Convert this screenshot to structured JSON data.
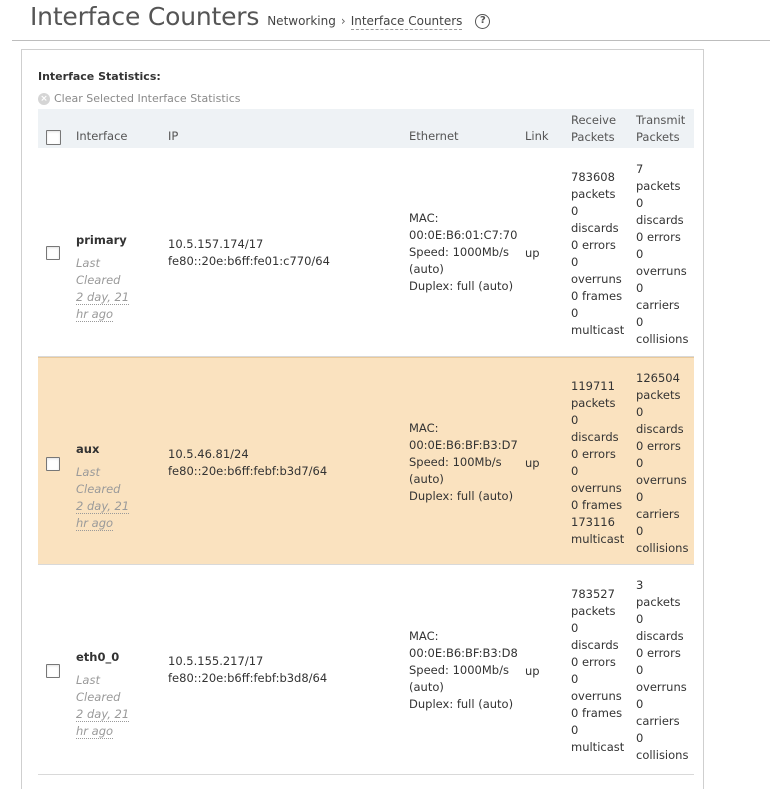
{
  "header": {
    "title": "Interface Counters",
    "breadcrumb_root": "Networking",
    "breadcrumb_sep": "›",
    "breadcrumb_current": "Interface Counters",
    "help_glyph": "?"
  },
  "section": {
    "title": "Interface Statistics:",
    "clear_label": "Clear Selected Interface Statistics"
  },
  "columns": {
    "interface": "Interface",
    "ip": "IP",
    "ethernet": "Ethernet",
    "link": "Link",
    "receive": "Receive Packets",
    "transmit": "Transmit Packets"
  },
  "rows": [
    {
      "name": "primary",
      "last_cleared_label": "Last Cleared",
      "last_cleared_value": "2 day, 21 hr ago",
      "ipv4": "10.5.157.174/17",
      "ipv6": "fe80::20e:b6ff:fe01:c770/64",
      "mac_label": "MAC:",
      "mac": "00:0E:B6:01:C7:70",
      "speed": "Speed: 1000Mb/s",
      "speed_mode": "(auto)",
      "duplex": "Duplex: full (auto)",
      "link": "up",
      "rx": [
        "783608",
        "packets",
        "0",
        "discards",
        "0 errors",
        "0",
        "overruns",
        "0 frames",
        "0",
        "multicast"
      ],
      "tx": [
        "7",
        "packets",
        "0",
        "discards",
        "0 errors",
        "0",
        "overruns",
        "0",
        "carriers",
        "0",
        "collisions"
      ]
    },
    {
      "name": "aux",
      "last_cleared_label": "Last Cleared",
      "last_cleared_value": "2 day, 21 hr ago",
      "ipv4": "10.5.46.81/24",
      "ipv6": "fe80::20e:b6ff:febf:b3d7/64",
      "mac_label": "MAC:",
      "mac": "00:0E:B6:BF:B3:D7",
      "speed": "Speed: 100Mb/s",
      "speed_mode": "(auto)",
      "duplex": "Duplex: full (auto)",
      "link": "up",
      "rx": [
        "119711",
        "packets",
        "0",
        "discards",
        "0 errors",
        "0",
        "overruns",
        "0 frames",
        "173116",
        "multicast"
      ],
      "tx": [
        "126504",
        "packets",
        "0",
        "discards",
        "0 errors",
        "0",
        "overruns",
        "0",
        "carriers",
        "0",
        "collisions"
      ]
    },
    {
      "name": "eth0_0",
      "last_cleared_label": "Last Cleared",
      "last_cleared_value": "2 day, 21 hr ago",
      "ipv4": "10.5.155.217/17",
      "ipv6": "fe80::20e:b6ff:febf:b3d8/64",
      "mac_label": "MAC:",
      "mac": "00:0E:B6:BF:B3:D8",
      "speed": "Speed: 1000Mb/s",
      "speed_mode": "(auto)",
      "duplex": "Duplex: full (auto)",
      "link": "up",
      "rx": [
        "783527",
        "packets",
        "0",
        "discards",
        "0 errors",
        "0",
        "overruns",
        "0 frames",
        "0",
        "multicast"
      ],
      "tx": [
        "3",
        "packets",
        "0",
        "discards",
        "0 errors",
        "0",
        "overruns",
        "0",
        "carriers",
        "0",
        "collisions"
      ]
    }
  ]
}
